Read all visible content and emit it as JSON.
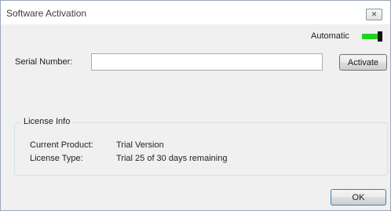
{
  "window": {
    "title": "Software Activation",
    "close_glyph": "✕"
  },
  "mode": {
    "label": "Automatic",
    "toggle_on": true,
    "toggle_color": "#1fd41f"
  },
  "serial": {
    "label": "Serial Number:",
    "value": "",
    "placeholder": "",
    "activate_label": "Activate"
  },
  "license_info": {
    "title": "License Info",
    "current_product_label": "Current Product:",
    "current_product_value": "Trial Version",
    "license_type_label": "License Type:",
    "license_type_value": "Trial 25 of 30 days remaining"
  },
  "footer": {
    "ok_label": "OK"
  }
}
